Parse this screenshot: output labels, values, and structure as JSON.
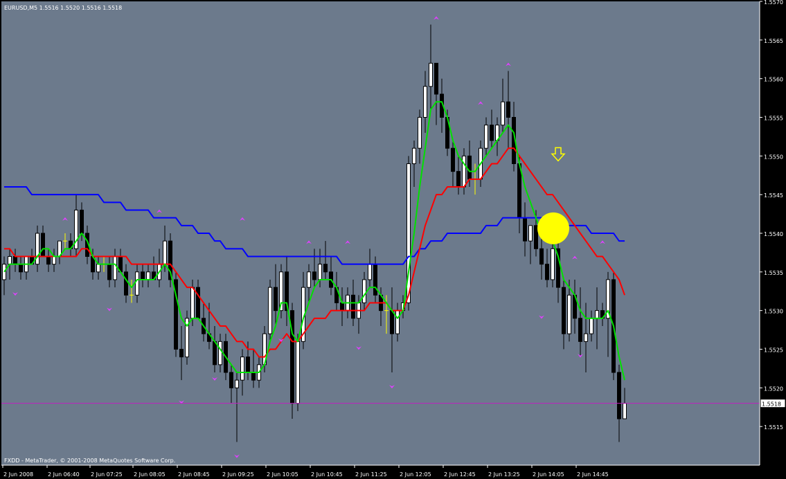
{
  "window": {
    "header": "EURUSD,M5  1.5516 1.5520 1.5516 1.5518",
    "footer": "FXDD - MetaTrader, © 2001-2008 MetaQuotes Software Corp.",
    "current_price_label": "1.5518"
  },
  "colors": {
    "plot_bg": "#6c7a8c",
    "frame": "#000000",
    "bull_candle": "#ffffff",
    "bear_candle": "#000000",
    "wick": "#000000",
    "doji": "#ffff00",
    "ma_fast": "#00e000",
    "ma_mid": "#ff0000",
    "ma_slow": "#0000ff",
    "fractal": "#e040ff",
    "price_line": "#c020c0",
    "marker": "#ffff00",
    "axis_text": "#ffffff"
  },
  "chart_data": {
    "type": "candlestick",
    "symbol": "EURUSD",
    "timeframe": "M5",
    "ylim": [
      1.551,
      1.557
    ],
    "y_ticks": [
      "1.5515",
      "1.5520",
      "1.5525",
      "1.5530",
      "1.5535",
      "1.5540",
      "1.5545",
      "1.5550",
      "1.5555",
      "1.5560",
      "1.5565",
      "1.5570"
    ],
    "x_ticks": [
      "2 Jun 2008",
      "2 Jun 06:40",
      "2 Jun 07:25",
      "2 Jun 08:05",
      "2 Jun 08:45",
      "2 Jun 09:25",
      "2 Jun 10:05",
      "2 Jun 10:45",
      "2 Jun 11:25",
      "2 Jun 12:05",
      "2 Jun 12:45",
      "2 Jun 13:25",
      "2 Jun 14:05",
      "2 Jun 14:45"
    ],
    "current_price": 1.5518,
    "bar_count": 107,
    "candles": [
      [
        1.5534,
        1.5537,
        1.5532,
        1.5536
      ],
      [
        1.5536,
        1.5538,
        1.5534,
        1.5537
      ],
      [
        1.5537,
        1.5538,
        1.5535,
        1.5536
      ],
      [
        1.5536,
        1.5537,
        1.5534,
        1.5535
      ],
      [
        1.5535,
        1.5537,
        1.5534,
        1.5537
      ],
      [
        1.5537,
        1.5538,
        1.5536,
        1.5536
      ],
      [
        1.5536,
        1.5541,
        1.5535,
        1.554
      ],
      [
        1.554,
        1.5541,
        1.5537,
        1.5537
      ],
      [
        1.5537,
        1.5538,
        1.5535,
        1.5536
      ],
      [
        1.5536,
        1.5538,
        1.5535,
        1.5537
      ],
      [
        1.5537,
        1.5539,
        1.5536,
        1.5539
      ],
      [
        1.5539,
        1.554,
        1.5538,
        1.5539
      ],
      [
        1.5539,
        1.554,
        1.5537,
        1.5538
      ],
      [
        1.5538,
        1.5545,
        1.5537,
        1.5543
      ],
      [
        1.5543,
        1.5544,
        1.5539,
        1.554
      ],
      [
        1.554,
        1.5541,
        1.5536,
        1.5537
      ],
      [
        1.5537,
        1.5538,
        1.5534,
        1.5535
      ],
      [
        1.5535,
        1.5537,
        1.5534,
        1.5536
      ],
      [
        1.5536,
        1.5537,
        1.5535,
        1.5536
      ],
      [
        1.5536,
        1.5537,
        1.5533,
        1.5534
      ],
      [
        1.5534,
        1.5538,
        1.5533,
        1.5537
      ],
      [
        1.5537,
        1.5538,
        1.5535,
        1.5535
      ],
      [
        1.5535,
        1.5536,
        1.5531,
        1.5532
      ],
      [
        1.5532,
        1.5534,
        1.5531,
        1.5532
      ],
      [
        1.5532,
        1.5536,
        1.5531,
        1.5535
      ],
      [
        1.5535,
        1.5536,
        1.5533,
        1.5534
      ],
      [
        1.5534,
        1.5536,
        1.5533,
        1.5535
      ],
      [
        1.5535,
        1.5537,
        1.5534,
        1.5534
      ],
      [
        1.5534,
        1.5538,
        1.5533,
        1.5536
      ],
      [
        1.5536,
        1.5541,
        1.5535,
        1.5539
      ],
      [
        1.5539,
        1.554,
        1.5533,
        1.5534
      ],
      [
        1.5534,
        1.5535,
        1.5524,
        1.5525
      ],
      [
        1.5525,
        1.5528,
        1.5521,
        1.5524
      ],
      [
        1.5524,
        1.553,
        1.5523,
        1.5529
      ],
      [
        1.5529,
        1.5534,
        1.5528,
        1.5533
      ],
      [
        1.5533,
        1.5534,
        1.5529,
        1.5529
      ],
      [
        1.5529,
        1.5531,
        1.5526,
        1.5527
      ],
      [
        1.5527,
        1.5531,
        1.5525,
        1.5526
      ],
      [
        1.5526,
        1.5528,
        1.5522,
        1.5523
      ],
      [
        1.5523,
        1.5527,
        1.5522,
        1.5526
      ],
      [
        1.5526,
        1.5527,
        1.5521,
        1.5522
      ],
      [
        1.5522,
        1.5523,
        1.5518,
        1.552
      ],
      [
        1.552,
        1.5522,
        1.5513,
        1.5521
      ],
      [
        1.5521,
        1.5525,
        1.5519,
        1.5524
      ],
      [
        1.5524,
        1.5526,
        1.5521,
        1.5522
      ],
      [
        1.5522,
        1.5525,
        1.552,
        1.5521
      ],
      [
        1.5521,
        1.5524,
        1.552,
        1.5523
      ],
      [
        1.5523,
        1.5528,
        1.5522,
        1.5527
      ],
      [
        1.5527,
        1.5534,
        1.5526,
        1.5533
      ],
      [
        1.5533,
        1.5536,
        1.5528,
        1.553
      ],
      [
        1.553,
        1.5536,
        1.5529,
        1.5535
      ],
      [
        1.5535,
        1.5537,
        1.5528,
        1.553
      ],
      [
        1.553,
        1.5531,
        1.5516,
        1.5518
      ],
      [
        1.5518,
        1.5527,
        1.5517,
        1.5526
      ],
      [
        1.5526,
        1.5535,
        1.5525,
        1.5533
      ],
      [
        1.5533,
        1.5536,
        1.5531,
        1.5535
      ],
      [
        1.5535,
        1.5538,
        1.5533,
        1.5534
      ],
      [
        1.5534,
        1.5538,
        1.5533,
        1.5536
      ],
      [
        1.5536,
        1.5539,
        1.5534,
        1.5535
      ],
      [
        1.5535,
        1.5537,
        1.5532,
        1.5533
      ],
      [
        1.5533,
        1.5535,
        1.553,
        1.5531
      ],
      [
        1.5531,
        1.5533,
        1.5528,
        1.553
      ],
      [
        1.553,
        1.5533,
        1.5529,
        1.5532
      ],
      [
        1.5532,
        1.5534,
        1.5528,
        1.5529
      ],
      [
        1.5529,
        1.5532,
        1.5527,
        1.5531
      ],
      [
        1.5531,
        1.5535,
        1.553,
        1.5534
      ],
      [
        1.5534,
        1.5538,
        1.5533,
        1.5536
      ],
      [
        1.5536,
        1.5537,
        1.5531,
        1.5532
      ],
      [
        1.5532,
        1.5533,
        1.5528,
        1.553
      ],
      [
        1.553,
        1.5532,
        1.5527,
        1.553
      ],
      [
        1.553,
        1.5533,
        1.5522,
        1.5527
      ],
      [
        1.5527,
        1.5531,
        1.5526,
        1.553
      ],
      [
        1.553,
        1.5532,
        1.5529,
        1.5531
      ],
      [
        1.5531,
        1.555,
        1.553,
        1.5549
      ],
      [
        1.5549,
        1.5552,
        1.5546,
        1.5551
      ],
      [
        1.5551,
        1.5556,
        1.5549,
        1.5555
      ],
      [
        1.5555,
        1.5561,
        1.5553,
        1.5559
      ],
      [
        1.5559,
        1.5567,
        1.5556,
        1.5562
      ],
      [
        1.5562,
        1.5562,
        1.5554,
        1.5558
      ],
      [
        1.5558,
        1.556,
        1.5553,
        1.5555
      ],
      [
        1.5555,
        1.5556,
        1.555,
        1.5551
      ],
      [
        1.5551,
        1.5552,
        1.5546,
        1.5548
      ],
      [
        1.5548,
        1.555,
        1.5545,
        1.5546
      ],
      [
        1.5546,
        1.5551,
        1.5545,
        1.555
      ],
      [
        1.555,
        1.5552,
        1.5546,
        1.5547
      ],
      [
        1.5547,
        1.5549,
        1.5545,
        1.5547
      ],
      [
        1.5547,
        1.5552,
        1.5546,
        1.5551
      ],
      [
        1.5551,
        1.5555,
        1.555,
        1.5554
      ],
      [
        1.5554,
        1.5556,
        1.5551,
        1.5552
      ],
      [
        1.5552,
        1.5555,
        1.555,
        1.5554
      ],
      [
        1.5554,
        1.556,
        1.5553,
        1.5557
      ],
      [
        1.5557,
        1.5561,
        1.5551,
        1.5555
      ],
      [
        1.5555,
        1.5557,
        1.5548,
        1.5549
      ],
      [
        1.5549,
        1.555,
        1.554,
        1.5542
      ],
      [
        1.5542,
        1.5544,
        1.5537,
        1.5539
      ],
      [
        1.5539,
        1.5541,
        1.5536,
        1.5541
      ],
      [
        1.5541,
        1.5543,
        1.5537,
        1.5538
      ],
      [
        1.5538,
        1.5541,
        1.5534,
        1.5536
      ],
      [
        1.5536,
        1.5538,
        1.5533,
        1.5534
      ],
      [
        1.5534,
        1.554,
        1.5533,
        1.5538
      ],
      [
        1.5538,
        1.554,
        1.5531,
        1.5533
      ],
      [
        1.5533,
        1.5534,
        1.5525,
        1.5527
      ],
      [
        1.5527,
        1.5534,
        1.5526,
        1.5532
      ],
      [
        1.5532,
        1.5534,
        1.5527,
        1.5529
      ],
      [
        1.5529,
        1.5533,
        1.5524,
        1.5526
      ],
      [
        1.5526,
        1.5531,
        1.5522,
        1.5527
      ],
      [
        1.5527,
        1.553,
        1.5526,
        1.5529
      ],
      [
        1.5529,
        1.5533,
        1.5525,
        1.553
      ],
      [
        1.553,
        1.5531,
        1.5528,
        1.5529
      ],
      [
        1.5529,
        1.5535,
        1.5524,
        1.5534
      ],
      [
        1.5534,
        1.5535,
        1.5521,
        1.5522
      ],
      [
        1.5522,
        1.5523,
        1.5513,
        1.5516
      ],
      [
        1.5516,
        1.552,
        1.5516,
        1.5518
      ]
    ],
    "ma_fast": [
      1.5535,
      1.5536,
      1.5536,
      1.5536,
      1.5536,
      1.5536,
      1.5537,
      1.5538,
      1.5538,
      1.5537,
      1.5537,
      1.5538,
      1.5538,
      1.5539,
      1.554,
      1.5539,
      1.5537,
      1.5536,
      1.5536,
      1.5536,
      1.5536,
      1.5535,
      1.5534,
      1.5533,
      1.5534,
      1.5534,
      1.5534,
      1.5534,
      1.5535,
      1.5536,
      1.5535,
      1.5532,
      1.5529,
      1.5528,
      1.5529,
      1.5529,
      1.5528,
      1.5527,
      1.5526,
      1.5525,
      1.5524,
      1.5523,
      1.5522,
      1.5522,
      1.5522,
      1.5522,
      1.5522,
      1.5523,
      1.5526,
      1.5528,
      1.5531,
      1.5531,
      1.5527,
      1.5526,
      1.5529,
      1.5531,
      1.5533,
      1.5534,
      1.5534,
      1.5534,
      1.5533,
      1.5531,
      1.5531,
      1.5531,
      1.5531,
      1.5532,
      1.5533,
      1.5533,
      1.5532,
      1.5531,
      1.553,
      1.5529,
      1.553,
      1.5535,
      1.554,
      1.5546,
      1.5551,
      1.5556,
      1.5557,
      1.5557,
      1.5555,
      1.5552,
      1.555,
      1.5549,
      1.5548,
      1.5548,
      1.5549,
      1.555,
      1.5551,
      1.5552,
      1.5553,
      1.5554,
      1.5553,
      1.5549,
      1.5546,
      1.5544,
      1.5542,
      1.554,
      1.5539,
      1.5539,
      1.5537,
      1.5534,
      1.5533,
      1.5532,
      1.553,
      1.5529,
      1.5529,
      1.5529,
      1.5529,
      1.553,
      1.5528,
      1.5524,
      1.5521
    ],
    "ma_mid": [
      1.5538,
      1.5538,
      1.5537,
      1.5537,
      1.5537,
      1.5537,
      1.5537,
      1.5537,
      1.5537,
      1.5537,
      1.5537,
      1.5537,
      1.5537,
      1.5537,
      1.5538,
      1.5538,
      1.5537,
      1.5537,
      1.5537,
      1.5537,
      1.5537,
      1.5537,
      1.5537,
      1.5536,
      1.5536,
      1.5536,
      1.5536,
      1.5536,
      1.5536,
      1.5536,
      1.5536,
      1.5535,
      1.5534,
      1.5533,
      1.5533,
      1.5532,
      1.5531,
      1.553,
      1.5529,
      1.5528,
      1.5528,
      1.5527,
      1.5526,
      1.5526,
      1.5525,
      1.5525,
      1.5524,
      1.5524,
      1.5525,
      1.5525,
      1.5526,
      1.5527,
      1.5526,
      1.5526,
      1.5527,
      1.5528,
      1.5529,
      1.5529,
      1.5529,
      1.553,
      1.553,
      1.553,
      1.553,
      1.553,
      1.553,
      1.553,
      1.5531,
      1.5531,
      1.5531,
      1.5531,
      1.553,
      1.553,
      1.553,
      1.5532,
      1.5535,
      1.5538,
      1.5541,
      1.5543,
      1.5545,
      1.5545,
      1.5546,
      1.5546,
      1.5546,
      1.5546,
      1.5547,
      1.5547,
      1.5547,
      1.5548,
      1.5549,
      1.5549,
      1.555,
      1.5551,
      1.5551,
      1.555,
      1.5549,
      1.5548,
      1.5547,
      1.5546,
      1.5545,
      1.5545,
      1.5544,
      1.5543,
      1.5542,
      1.5541,
      1.554,
      1.5539,
      1.5538,
      1.5537,
      1.5537,
      1.5536,
      1.5535,
      1.5534,
      1.5532
    ],
    "ma_slow": [
      1.5546,
      1.5546,
      1.5546,
      1.5546,
      1.5546,
      1.5545,
      1.5545,
      1.5545,
      1.5545,
      1.5545,
      1.5545,
      1.5545,
      1.5545,
      1.5545,
      1.5545,
      1.5545,
      1.5545,
      1.5545,
      1.5544,
      1.5544,
      1.5544,
      1.5544,
      1.5543,
      1.5543,
      1.5543,
      1.5543,
      1.5543,
      1.5542,
      1.5542,
      1.5542,
      1.5542,
      1.5542,
      1.5541,
      1.5541,
      1.5541,
      1.554,
      1.554,
      1.554,
      1.5539,
      1.5539,
      1.5538,
      1.5538,
      1.5538,
      1.5538,
      1.5537,
      1.5537,
      1.5537,
      1.5537,
      1.5537,
      1.5537,
      1.5537,
      1.5537,
      1.5537,
      1.5537,
      1.5537,
      1.5537,
      1.5537,
      1.5537,
      1.5537,
      1.5537,
      1.5537,
      1.5536,
      1.5536,
      1.5536,
      1.5536,
      1.5536,
      1.5536,
      1.5536,
      1.5536,
      1.5536,
      1.5536,
      1.5536,
      1.5536,
      1.5537,
      1.5537,
      1.5538,
      1.5538,
      1.5539,
      1.5539,
      1.5539,
      1.554,
      1.554,
      1.554,
      1.554,
      1.554,
      1.554,
      1.554,
      1.5541,
      1.5541,
      1.5541,
      1.5542,
      1.5542,
      1.5542,
      1.5542,
      1.5542,
      1.5542,
      1.5542,
      1.5542,
      1.5542,
      1.5542,
      1.5542,
      1.5541,
      1.5541,
      1.5541,
      1.5541,
      1.5541,
      1.554,
      1.554,
      1.554,
      1.554,
      1.554,
      1.5539,
      1.5539
    ],
    "fractals_up": [
      [
        11,
        1.5541
      ],
      [
        28,
        1.5542
      ],
      [
        43,
        1.5541
      ],
      [
        55,
        1.5538
      ],
      [
        62,
        1.5538
      ],
      [
        78,
        1.5567
      ],
      [
        86,
        1.5556
      ],
      [
        91,
        1.5561
      ],
      [
        103,
        1.5536
      ],
      [
        108,
        1.5538
      ]
    ],
    "fractals_down": [
      [
        2,
        1.5533
      ],
      [
        19,
        1.5531
      ],
      [
        32,
        1.5519
      ],
      [
        38,
        1.5522
      ],
      [
        42,
        1.5512
      ],
      [
        50,
        1.5527
      ],
      [
        64,
        1.5526
      ],
      [
        70,
        1.5521
      ],
      [
        97,
        1.553
      ],
      [
        104,
        1.5525
      ]
    ],
    "arrow_marker": [
      100,
      1.555
    ],
    "highlight": [
      99,
      1.5541
    ]
  }
}
